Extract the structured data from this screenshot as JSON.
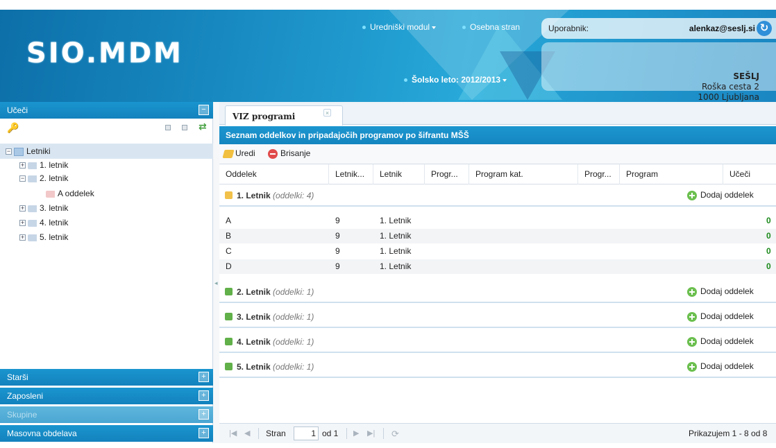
{
  "header": {
    "logo": "SIO.MDM",
    "nav": {
      "editor_module": "Uredniški modul",
      "personal_page": "Osebna stran"
    },
    "school_year": "Šolsko leto: 2012/2013",
    "user_label": "Uporabnik:",
    "user_email": "alenkaz@seslj.si",
    "org": {
      "name": "SEŠLJ",
      "street": "Roška cesta 2",
      "city": "1000 Ljubljana"
    }
  },
  "sidebar": {
    "sections": {
      "ucenci": "Učeči",
      "starsi": "Starši",
      "zaposleni": "Zaposleni",
      "skupine": "Skupine",
      "masovna": "Masovna obdelava"
    },
    "tree": {
      "root": "Letniki",
      "items": [
        "1. letnik",
        "2. letnik",
        "A oddelek",
        "3. letnik",
        "4. letnik",
        "5. letnik"
      ]
    }
  },
  "main": {
    "tab_label": "VIZ programi",
    "grid_title": "Seznam oddelkov in pripadajočih programov po šifrantu MŠŠ",
    "toolbar": {
      "edit": "Uredi",
      "delete": "Brisanje"
    },
    "columns": [
      "Oddelek",
      "Letnik...",
      "Letnik",
      "Progr...",
      "Program kat.",
      "Progr...",
      "Program",
      "Učeči"
    ],
    "add_label": "Dodaj oddelek",
    "groups": [
      {
        "label": "1. Letnik",
        "count": "(oddelki: 4)"
      },
      {
        "label": "2. Letnik",
        "count": "(oddelki: 1)"
      },
      {
        "label": "3. Letnik",
        "count": "(oddelki: 1)"
      },
      {
        "label": "4. Letnik",
        "count": "(oddelki: 1)"
      },
      {
        "label": "5. Letnik",
        "count": "(oddelki: 1)"
      }
    ],
    "rows": [
      {
        "oddelek": "A",
        "letnik_id": "9",
        "letnik": "1. Letnik",
        "ucenci": "0"
      },
      {
        "oddelek": "B",
        "letnik_id": "9",
        "letnik": "1. Letnik",
        "ucenci": "0"
      },
      {
        "oddelek": "C",
        "letnik_id": "9",
        "letnik": "1. Letnik",
        "ucenci": "0"
      },
      {
        "oddelek": "D",
        "letnik_id": "9",
        "letnik": "1. Letnik",
        "ucenci": "0"
      }
    ],
    "pager": {
      "page_label": "Stran",
      "page": "1",
      "of": "od 1",
      "summary": "Prikazujem 1 - 8 od 8"
    }
  }
}
